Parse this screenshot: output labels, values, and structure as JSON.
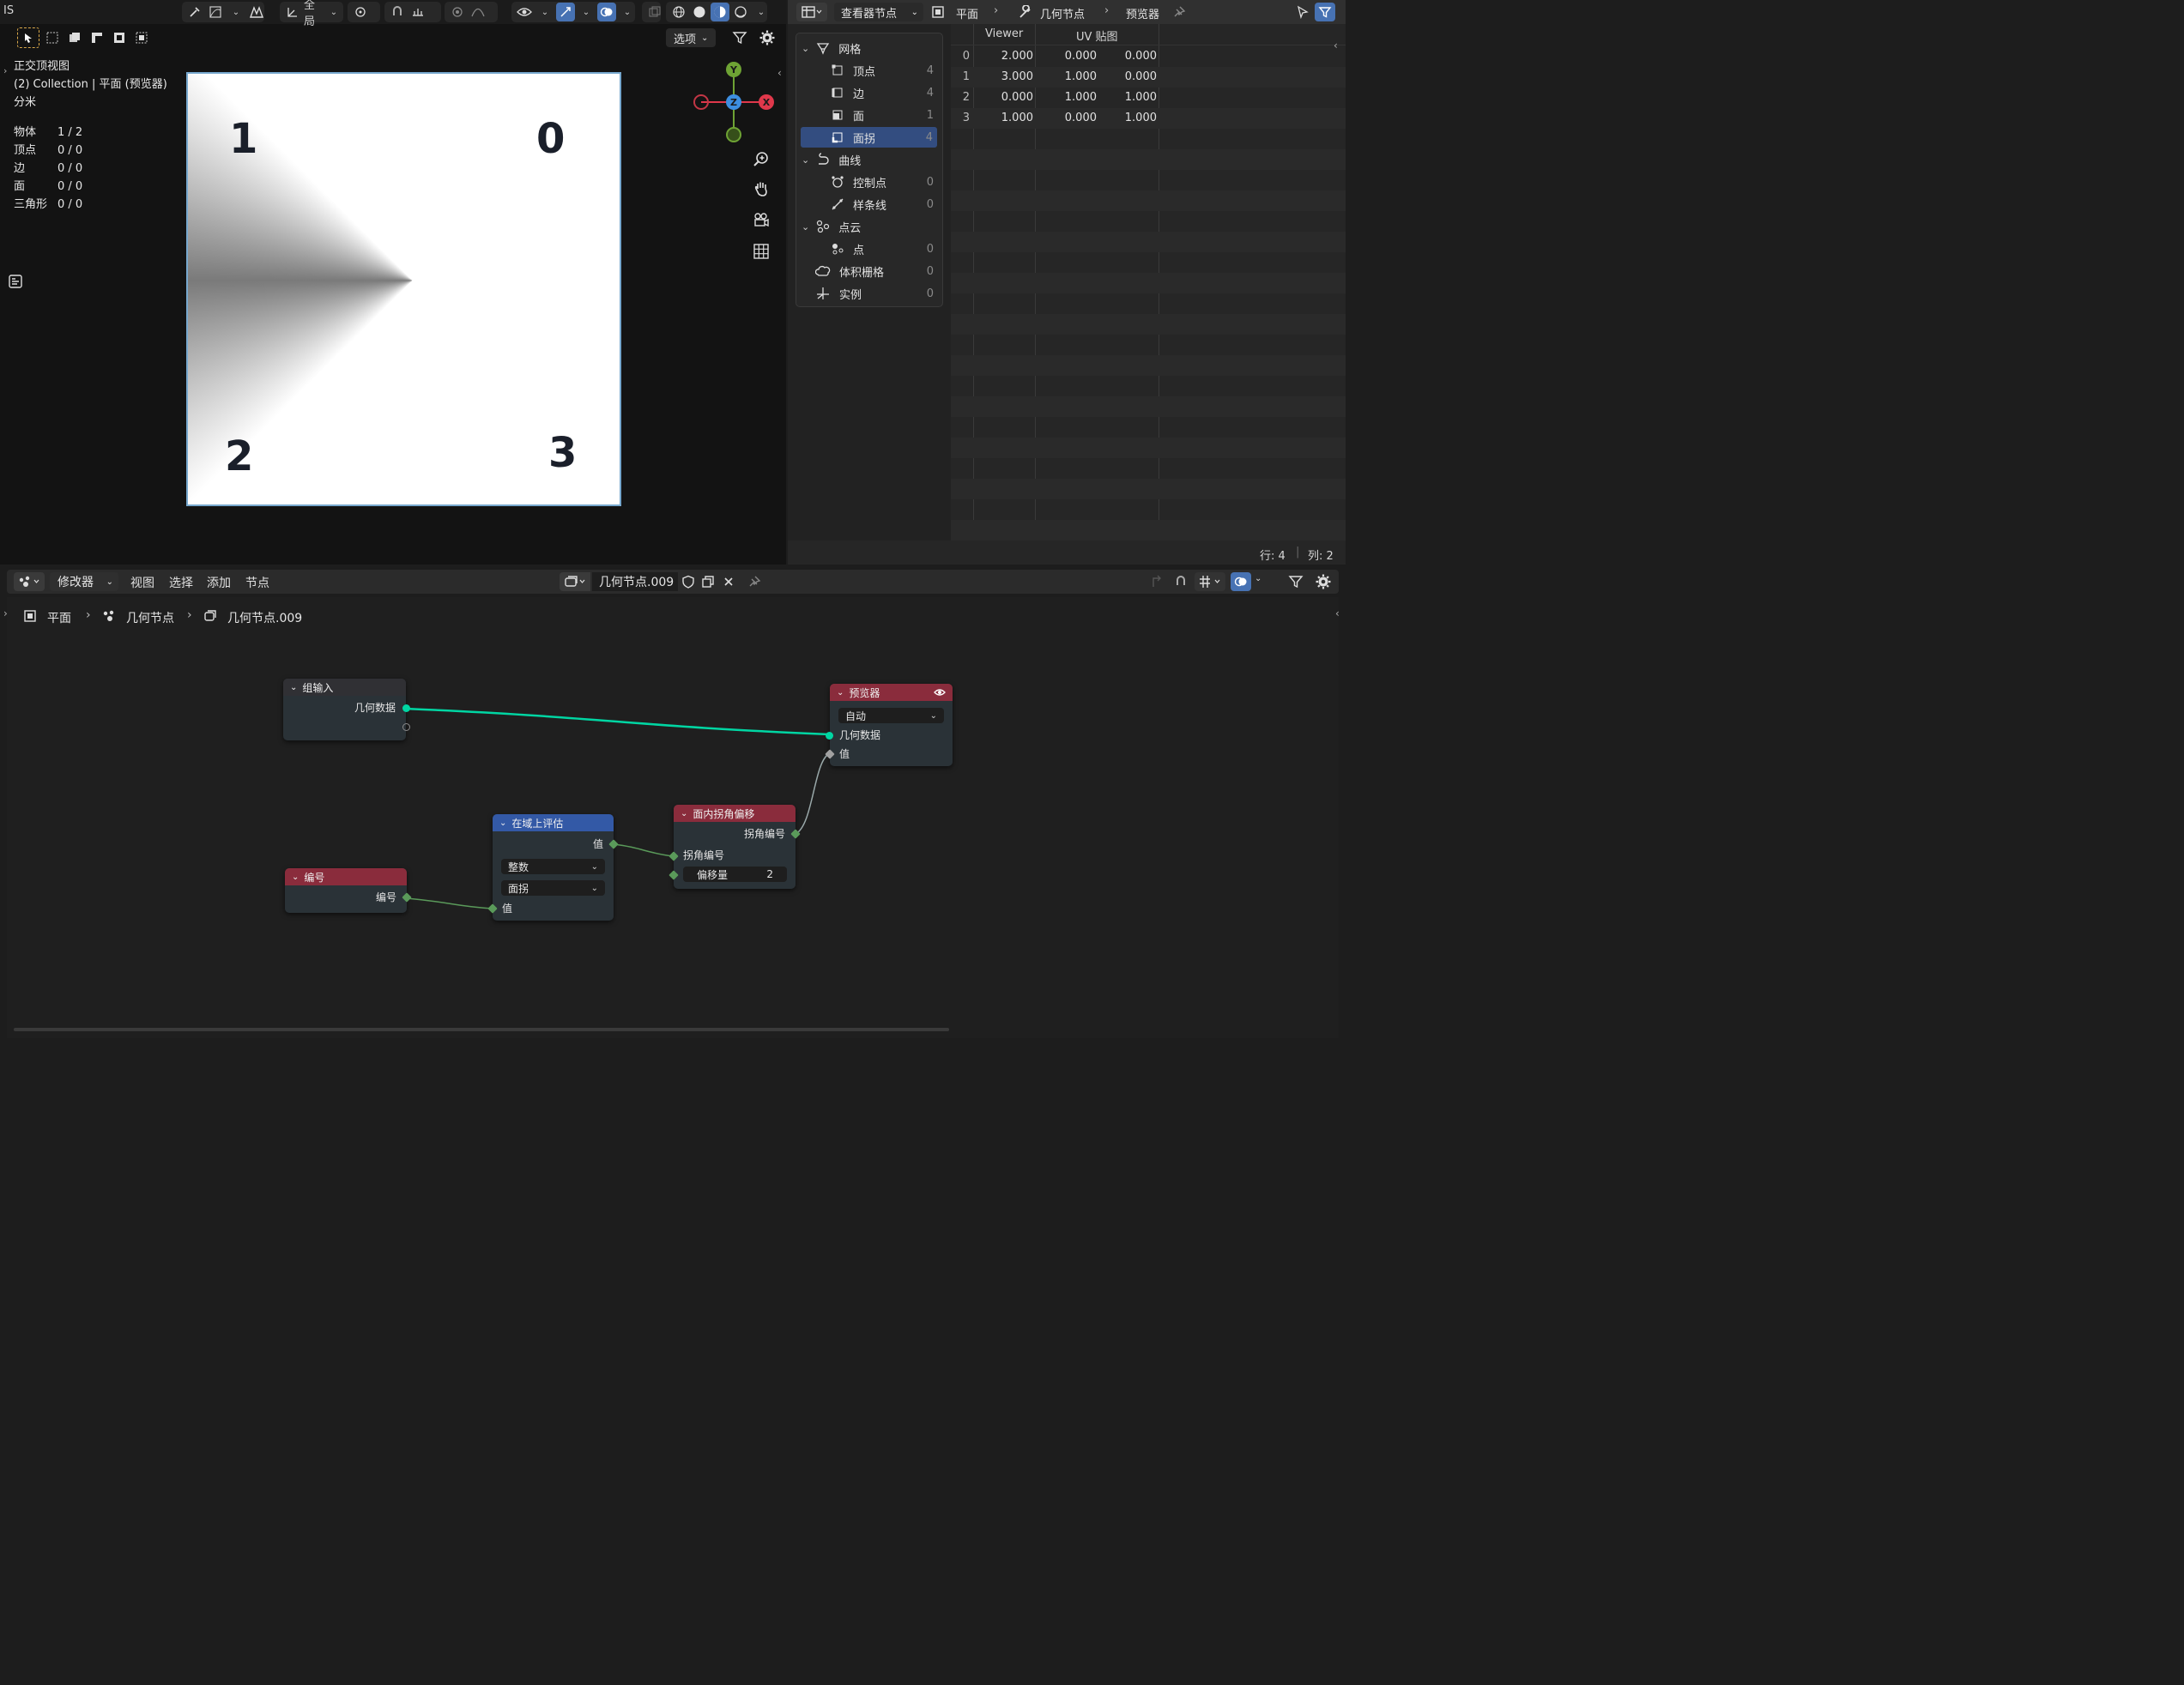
{
  "viewport": {
    "header": {
      "transform_orientation": "全局",
      "options_label": "选项",
      "left_edge_text": "IS"
    },
    "overlay": {
      "view_name": "正交顶视图",
      "collection": "(2) Collection | 平面 (预览器)",
      "units": "分米",
      "stats": [
        {
          "label": "物体",
          "value": "1 / 2"
        },
        {
          "label": "顶点",
          "value": "0 / 0"
        },
        {
          "label": "边",
          "value": "0 / 0"
        },
        {
          "label": "面",
          "value": "0 / 0"
        },
        {
          "label": "三角形",
          "value": "0 / 0"
        }
      ]
    },
    "corner_labels": [
      "1",
      "0",
      "2",
      "3"
    ],
    "gizmo": {
      "x": "X",
      "y": "Y",
      "z": "Z"
    }
  },
  "spreadsheet": {
    "header": {
      "display_mode": "查看器节点",
      "breadcrumb": [
        "平面",
        "几何节点",
        "预览器"
      ]
    },
    "tree": [
      {
        "label": "网格",
        "count": ""
      },
      {
        "label": "顶点",
        "count": "4"
      },
      {
        "label": "边",
        "count": "4"
      },
      {
        "label": "面",
        "count": "1"
      },
      {
        "label": "面拐",
        "count": "4"
      },
      {
        "label": "曲线",
        "count": ""
      },
      {
        "label": "控制点",
        "count": "0"
      },
      {
        "label": "样条线",
        "count": "0"
      },
      {
        "label": "点云",
        "count": ""
      },
      {
        "label": "点",
        "count": "0"
      },
      {
        "label": "体积栅格",
        "count": "0"
      },
      {
        "label": "实例",
        "count": "0"
      }
    ],
    "columns": [
      "Viewer",
      "UV 贴图"
    ],
    "rows": [
      {
        "index": "0",
        "viewer": "2.000",
        "uv_x": "0.000",
        "uv_y": "0.000"
      },
      {
        "index": "1",
        "viewer": "3.000",
        "uv_x": "1.000",
        "uv_y": "0.000"
      },
      {
        "index": "2",
        "viewer": "0.000",
        "uv_x": "1.000",
        "uv_y": "1.000"
      },
      {
        "index": "3",
        "viewer": "1.000",
        "uv_x": "0.000",
        "uv_y": "1.000"
      }
    ],
    "footer": {
      "rows": "行: 4",
      "cols": "列: 2"
    }
  },
  "node_editor": {
    "header": {
      "editor_type": "修改器",
      "menus": [
        "视图",
        "选择",
        "添加",
        "节点"
      ],
      "node_group": "几何节点.009"
    },
    "breadcrumb": [
      "平面",
      "几何节点",
      "几何节点.009"
    ],
    "nodes": {
      "group_input": {
        "title": "组输入",
        "output": "几何数据"
      },
      "viewer": {
        "title": "预览器",
        "domain": "自动",
        "input_geo": "几何数据",
        "input_value": "值"
      },
      "corner_offset": {
        "title": "面内拐角偏移",
        "output": "拐角编号",
        "input_corner": "拐角编号",
        "offset_label": "偏移量",
        "offset_value": "2"
      },
      "eval_on_domain": {
        "title": "在域上评估",
        "output": "值",
        "data_type": "整数",
        "domain": "面拐",
        "input": "值"
      },
      "index": {
        "title": "编号",
        "output": "编号"
      }
    },
    "colors": {
      "geometry_link": "#00d6a3",
      "int_link": "#5a9a5a",
      "gray_link": "#a1a1a1",
      "input_header": "#8a2c3c",
      "field_header": "#3359a6"
    }
  }
}
